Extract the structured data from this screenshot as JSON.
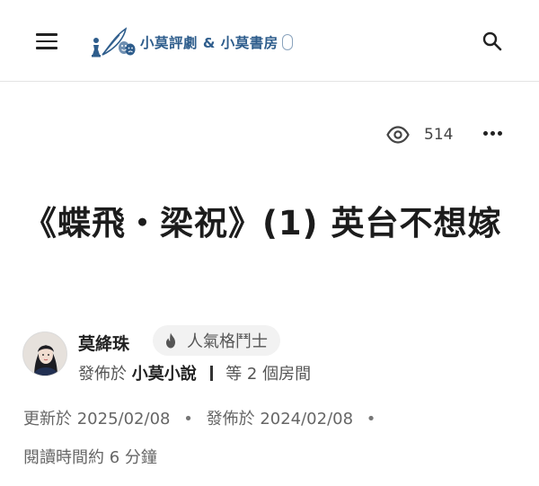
{
  "header": {
    "site_name": "小莫評劇 & 小莫書房",
    "colors": {
      "brand": "#2e5d8c",
      "border": "#e3e3e3"
    },
    "menu_icon": "hamburger-icon",
    "search_icon": "search-icon"
  },
  "article": {
    "views": "514",
    "title": "《蝶飛・梁祝》(1) 英台不想嫁",
    "author": {
      "name": "莫絳珠",
      "badge": "人氣格鬥士",
      "badge_icon": "fire-icon",
      "published_in_label": "發佈於",
      "publication": "小莫小說",
      "rooms": "等 2 個房間"
    },
    "updated_label": "更新於",
    "updated_date": "2025/02/08",
    "published_label": "發佈於",
    "published_date": "2024/02/08",
    "read_time": "閱讀時間約 6 分鐘"
  }
}
